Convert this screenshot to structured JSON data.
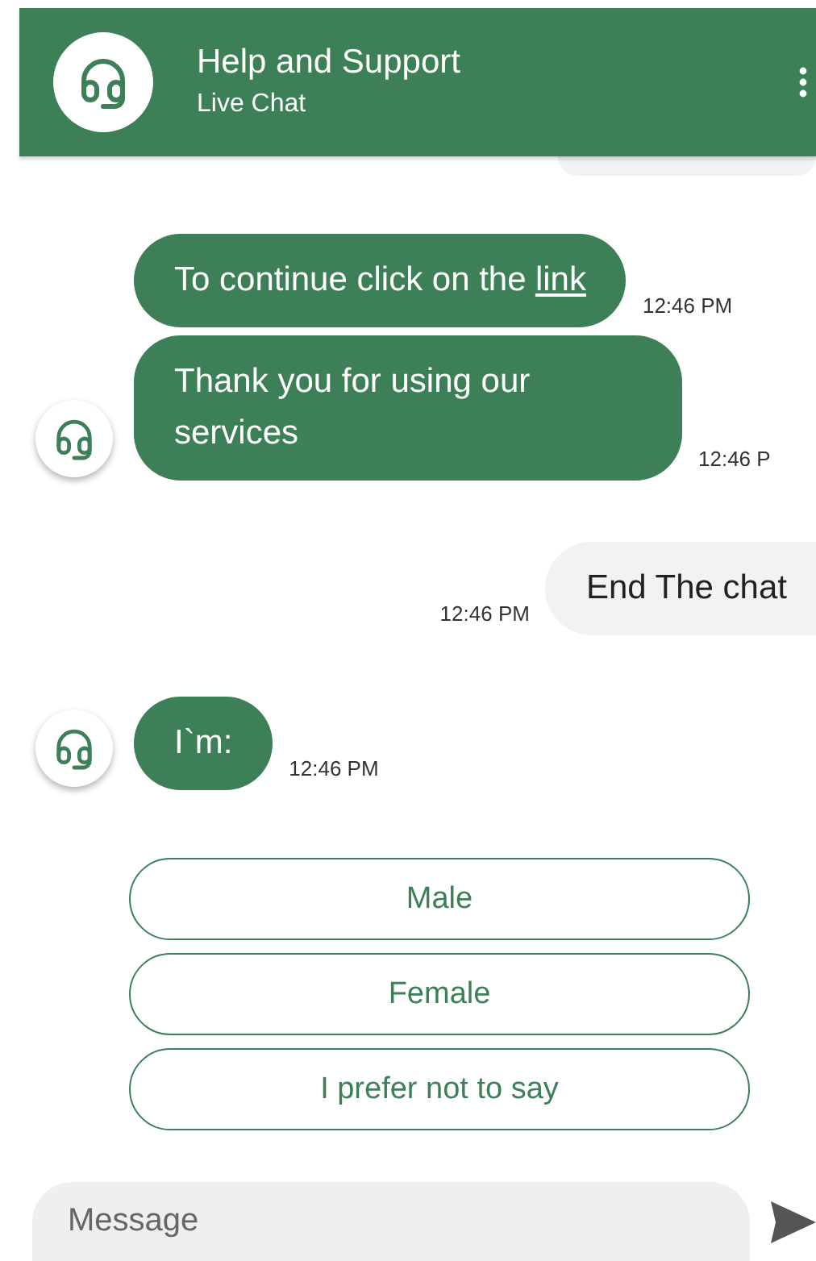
{
  "header": {
    "title": "Help and Support",
    "subtitle": "Live Chat"
  },
  "messages": [
    {
      "kind": "user_clipped"
    },
    {
      "kind": "bot",
      "text": "To continue click on the",
      "link": "link",
      "time": "12:46 PM",
      "avatar": false
    },
    {
      "kind": "bot",
      "text": "Thank you for using our services",
      "time": "12:46 P",
      "avatar": true
    },
    {
      "kind": "user",
      "text": "End The chat",
      "time": "12:46 PM"
    },
    {
      "kind": "bot",
      "text": "I`m:",
      "time": "12:46 PM",
      "avatar": true
    }
  ],
  "options": [
    "Male",
    "Female",
    "I prefer not to say"
  ],
  "composer": {
    "placeholder": "Message"
  }
}
